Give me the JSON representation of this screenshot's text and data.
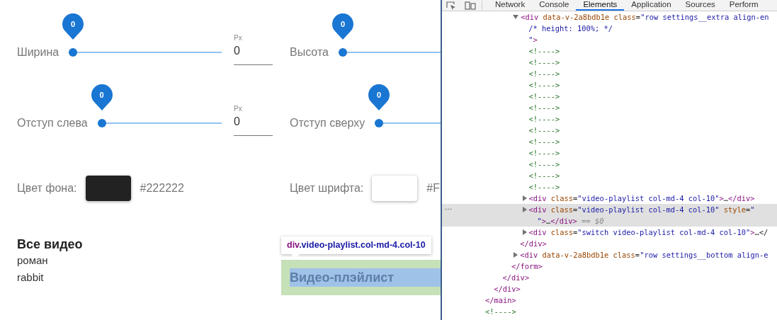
{
  "page": {
    "sliders": [
      {
        "label": "Ширина",
        "bubble": "0",
        "level": 0,
        "unit": "Px",
        "input_value": "0"
      },
      {
        "label": "Высота",
        "bubble": "0",
        "level": 0
      },
      {
        "label": "Отступ слева",
        "bubble": "0",
        "level": 0,
        "unit": "Px",
        "input_value": "0"
      },
      {
        "label": "Отступ сверху",
        "bubble": "0",
        "level": 0
      }
    ],
    "colors": [
      {
        "label": "Цвет фона:",
        "color": "#222222",
        "hex": "#222222"
      },
      {
        "label": "Цвет шрифта:",
        "color": "#ffffff",
        "hex": "#F"
      }
    ],
    "all_videos": {
      "title": "Все видео",
      "items": [
        "роман",
        "rabbit"
      ]
    },
    "playlist": {
      "title": "Видео-плэйлист"
    },
    "inspect_tooltip": {
      "tag": "div",
      "classes": ".video-playlist.col-md-4.col-10"
    }
  },
  "devtools": {
    "tabs": [
      {
        "label": "Network",
        "selected": false
      },
      {
        "label": "Console",
        "selected": false
      },
      {
        "label": "Elements",
        "selected": true
      },
      {
        "label": "Application",
        "selected": false
      },
      {
        "label": "Sources",
        "selected": false
      },
      {
        "label": "Perform",
        "selected": false
      }
    ],
    "dom_tree": [
      {
        "children": [
          {
            "children": [
              {
                "children": [
                  {
                    "children": [
                      {
                        "lines": [
                          "<div data-v-2a8bdb1e class=\"row settings__extra align-en",
                          "/* height: 100%; */",
                          "\">"
                        ],
                        "expanded": true,
                        "selected": false,
                        "children": [
                          {
                            "lines": [
                              "<!---->"
                            ],
                            "selected": false
                          },
                          {
                            "lines": [
                              "<!---->"
                            ],
                            "selected": false
                          },
                          {
                            "lines": [
                              "<!---->"
                            ],
                            "selected": false
                          },
                          {
                            "lines": [
                              "<!---->"
                            ],
                            "selected": false
                          },
                          {
                            "lines": [
                              "<!---->"
                            ],
                            "selected": false
                          },
                          {
                            "lines": [
                              "<!---->"
                            ],
                            "selected": false
                          },
                          {
                            "lines": [
                              "<!---->"
                            ],
                            "selected": false
                          },
                          {
                            "lines": [
                              "<!---->"
                            ],
                            "selected": false
                          },
                          {
                            "lines": [
                              "<!---->"
                            ],
                            "selected": false
                          },
                          {
                            "lines": [
                              "<!---->"
                            ],
                            "selected": false
                          },
                          {
                            "lines": [
                              "<!---->"
                            ],
                            "selected": false
                          },
                          {
                            "lines": [
                              "<!---->"
                            ],
                            "selected": false
                          },
                          {
                            "lines": [
                              "<!---->"
                            ],
                            "selected": false
                          },
                          {
                            "lines": [
                              "<div class=\"video-playlist col-md-4 col-10\">…</div>"
                            ],
                            "expanded": false,
                            "selected": false
                          },
                          {
                            "lines": [
                              "<div class=\"video-playlist col-md-4 col-10\" style=\"",
                              "\">…</div> == $0"
                            ],
                            "expanded": false,
                            "selected": true
                          },
                          {
                            "lines": [
                              "<div class=\"switch video-playlist col-md-4 col-10\">…</"
                            ],
                            "expanded": false,
                            "selected": false
                          }
                        ]
                      },
                      {
                        "lines": [
                          "</div>"
                        ]
                      },
                      {
                        "lines": [
                          "<div data-v-2a8bdb1e class=\"row settings__bottom align-e"
                        ],
                        "expanded": false,
                        "selected": false
                      }
                    ]
                  },
                  {
                    "lines": [
                      "</form>"
                    ]
                  }
                ]
              },
              {
                "lines": [
                  "</div>"
                ]
              }
            ]
          },
          {
            "lines": [
              "</div>"
            ]
          }
        ]
      },
      {
        "lines": [
          "</main>"
        ]
      },
      {
        "lines": [
          "<!---->"
        ],
        "selected": false
      }
    ]
  }
}
